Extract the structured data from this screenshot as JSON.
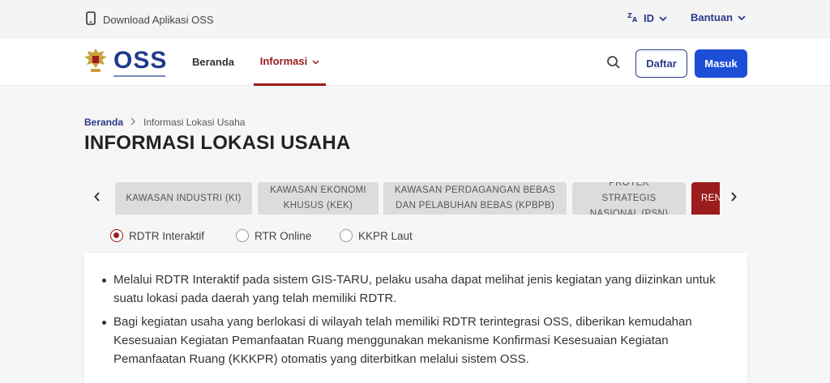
{
  "topbar": {
    "download_label": "Download Aplikasi OSS",
    "language": "ID",
    "help_label": "Bantuan"
  },
  "nav": {
    "logo_text": "OSS",
    "home": "Beranda",
    "info": "Informasi",
    "register": "Daftar",
    "login": "Masuk"
  },
  "breadcrumb": {
    "home": "Beranda",
    "separator": ">",
    "current": "Informasi Lokasi Usaha"
  },
  "page_title": "INFORMASI LOKASI USAHA",
  "tabs": [
    {
      "label": "KAWASAN INDUSTRI (KI)",
      "active": false
    },
    {
      "label": "KAWASAN EKONOMI KHUSUS (KEK)",
      "active": false
    },
    {
      "label": "KAWASAN PERDAGANGAN BEBAS DAN PELABUHAN BEBAS (KPBPB)",
      "active": false
    },
    {
      "label": "PROYEK STRATEGIS NASIONAL (PSN)",
      "active": false
    },
    {
      "label": "RENCANA",
      "active": true
    }
  ],
  "radios": [
    {
      "label": "RDTR Interaktif",
      "checked": true
    },
    {
      "label": "RTR Online",
      "checked": false
    },
    {
      "label": "KKPR Laut",
      "checked": false
    }
  ],
  "content": {
    "bullets": [
      "Melalui RDTR Interaktif pada sistem GIS-TARU, pelaku usaha dapat melihat jenis kegiatan yang diizinkan untuk suatu lokasi pada daerah yang telah memiliki RDTR.",
      "Bagi kegiatan usaha yang berlokasi di wilayah telah memiliki RDTR terintegrasi OSS, diberikan kemudahan Kesesuaian Kegiatan Pemanfaatan Ruang menggunakan mekanisme Konfirmasi Kesesuaian Kegiatan Pemanfaatan Ruang (KKKPR) otomatis yang diterbitkan melalui sistem OSS."
    ]
  },
  "colors": {
    "brand_blue": "#1d4ed8",
    "navy": "#2b3a8c",
    "accent_red": "#9b1c1c",
    "tab_gray": "#dcdcdc"
  }
}
